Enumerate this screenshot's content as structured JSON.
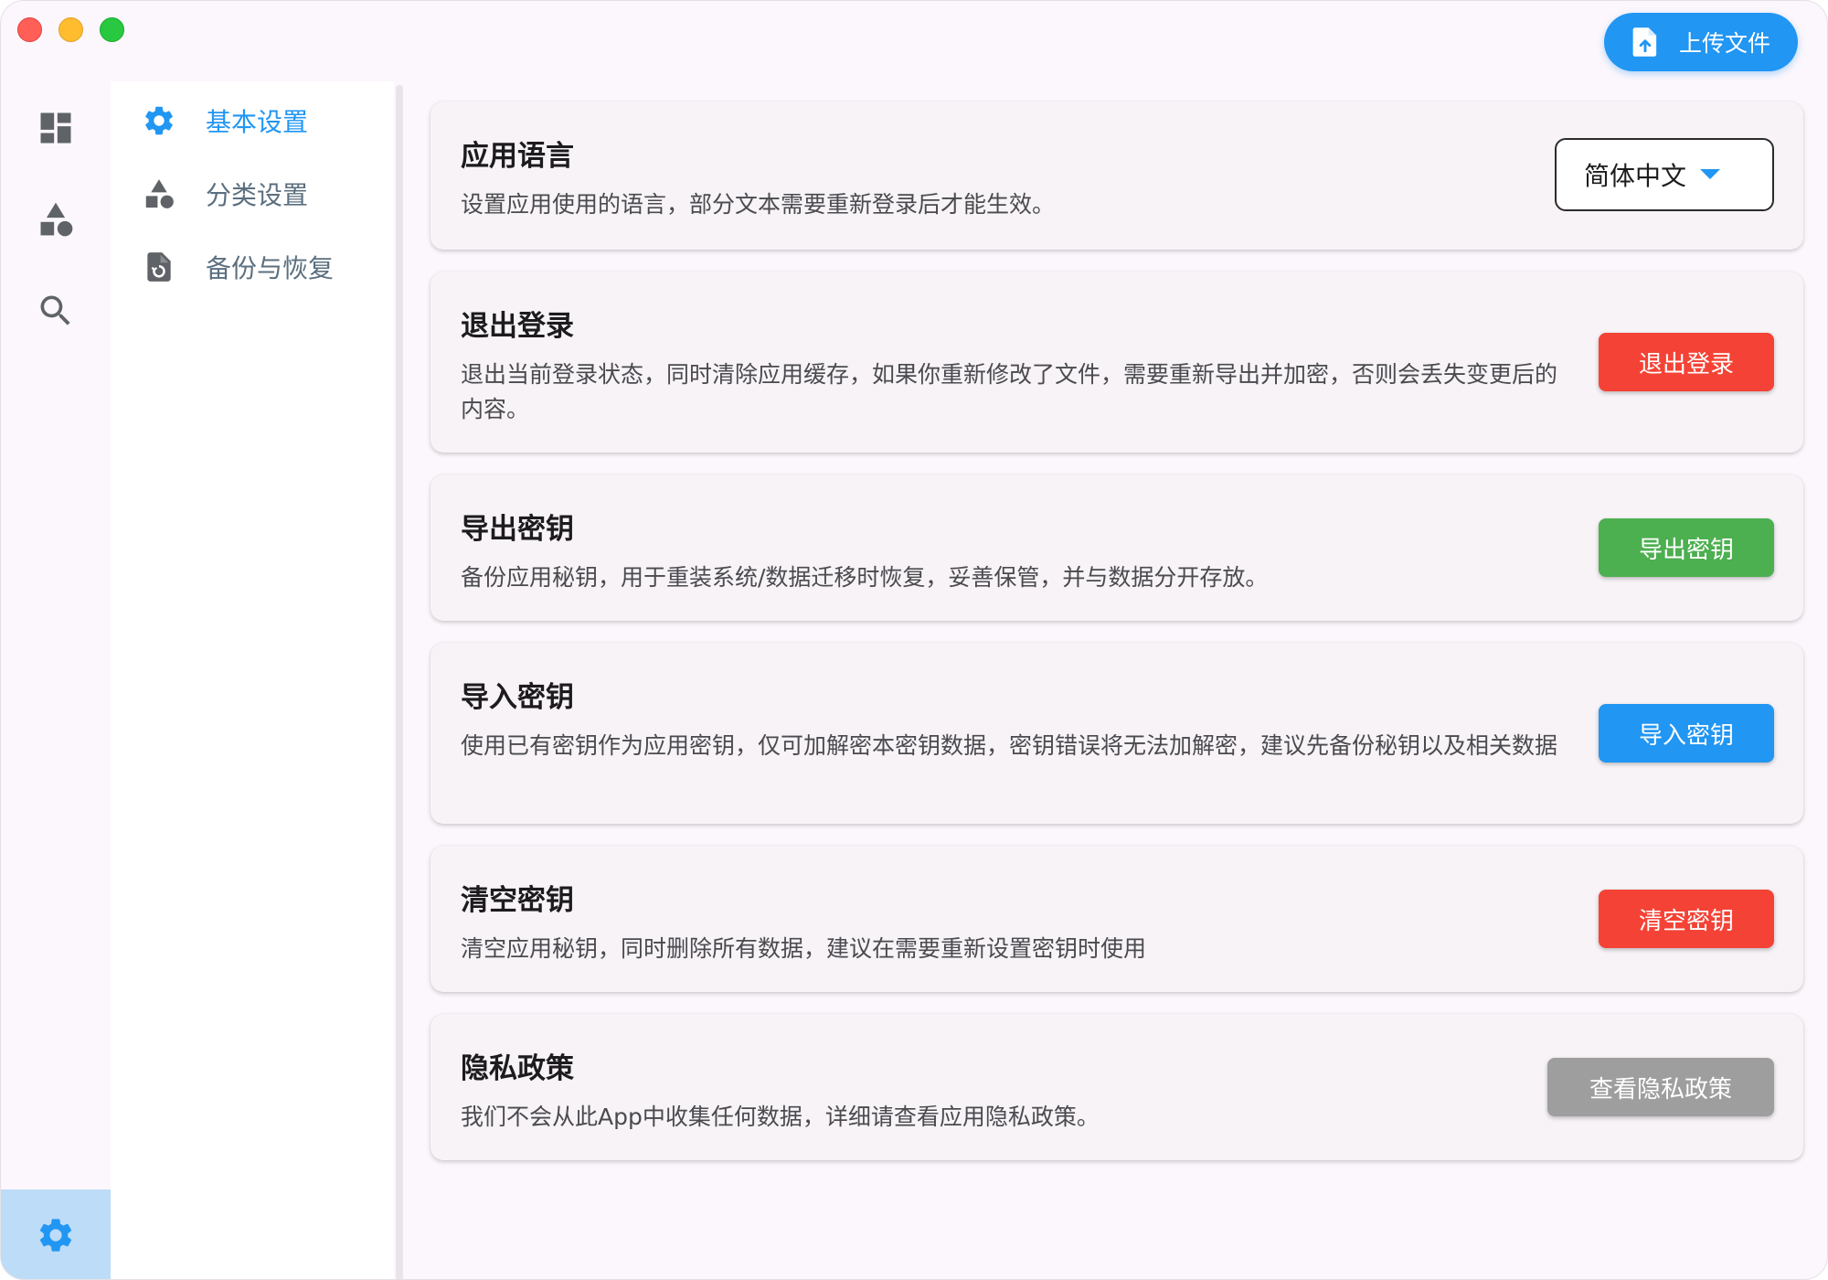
{
  "header": {
    "upload_label": "上传文件"
  },
  "rail": {
    "icons": [
      "dashboard-icon",
      "category-icon",
      "search-icon",
      "settings-icon"
    ]
  },
  "subnav": {
    "items": [
      {
        "label": "基本设置",
        "icon": "gear-icon",
        "active": true
      },
      {
        "label": "分类设置",
        "icon": "category-icon",
        "active": false
      },
      {
        "label": "备份与恢复",
        "icon": "restore-file-icon",
        "active": false
      }
    ]
  },
  "settings": {
    "language": {
      "title": "应用语言",
      "desc": "设置应用使用的语言，部分文本需要重新登录后才能生效。",
      "selected": "简体中文"
    },
    "logout": {
      "title": "退出登录",
      "desc": "退出当前登录状态，同时清除应用缓存，如果你重新修改了文件，需要重新导出并加密，否则会丢失变更后的内容。",
      "button": "退出登录"
    },
    "export_key": {
      "title": "导出密钥",
      "desc": "备份应用秘钥，用于重装系统/数据迁移时恢复，妥善保管，并与数据分开存放。",
      "button": "导出密钥"
    },
    "import_key": {
      "title": "导入密钥",
      "desc": "使用已有密钥作为应用密钥，仅可加解密本密钥数据，密钥错误将无法加解密，建议先备份秘钥以及相关数据",
      "button": "导入密钥"
    },
    "clear_key": {
      "title": "清空密钥",
      "desc": "清空应用秘钥，同时删除所有数据，建议在需要重新设置密钥时使用",
      "button": "清空密钥"
    },
    "privacy": {
      "title": "隐私政策",
      "desc": "我们不会从此App中收集任何数据，详细请查看应用隐私政策。",
      "button": "查看隐私政策"
    }
  },
  "colors": {
    "accent": "#2196f3",
    "danger": "#f44336",
    "success": "#4caf50",
    "neutral": "#9e9e9e"
  }
}
